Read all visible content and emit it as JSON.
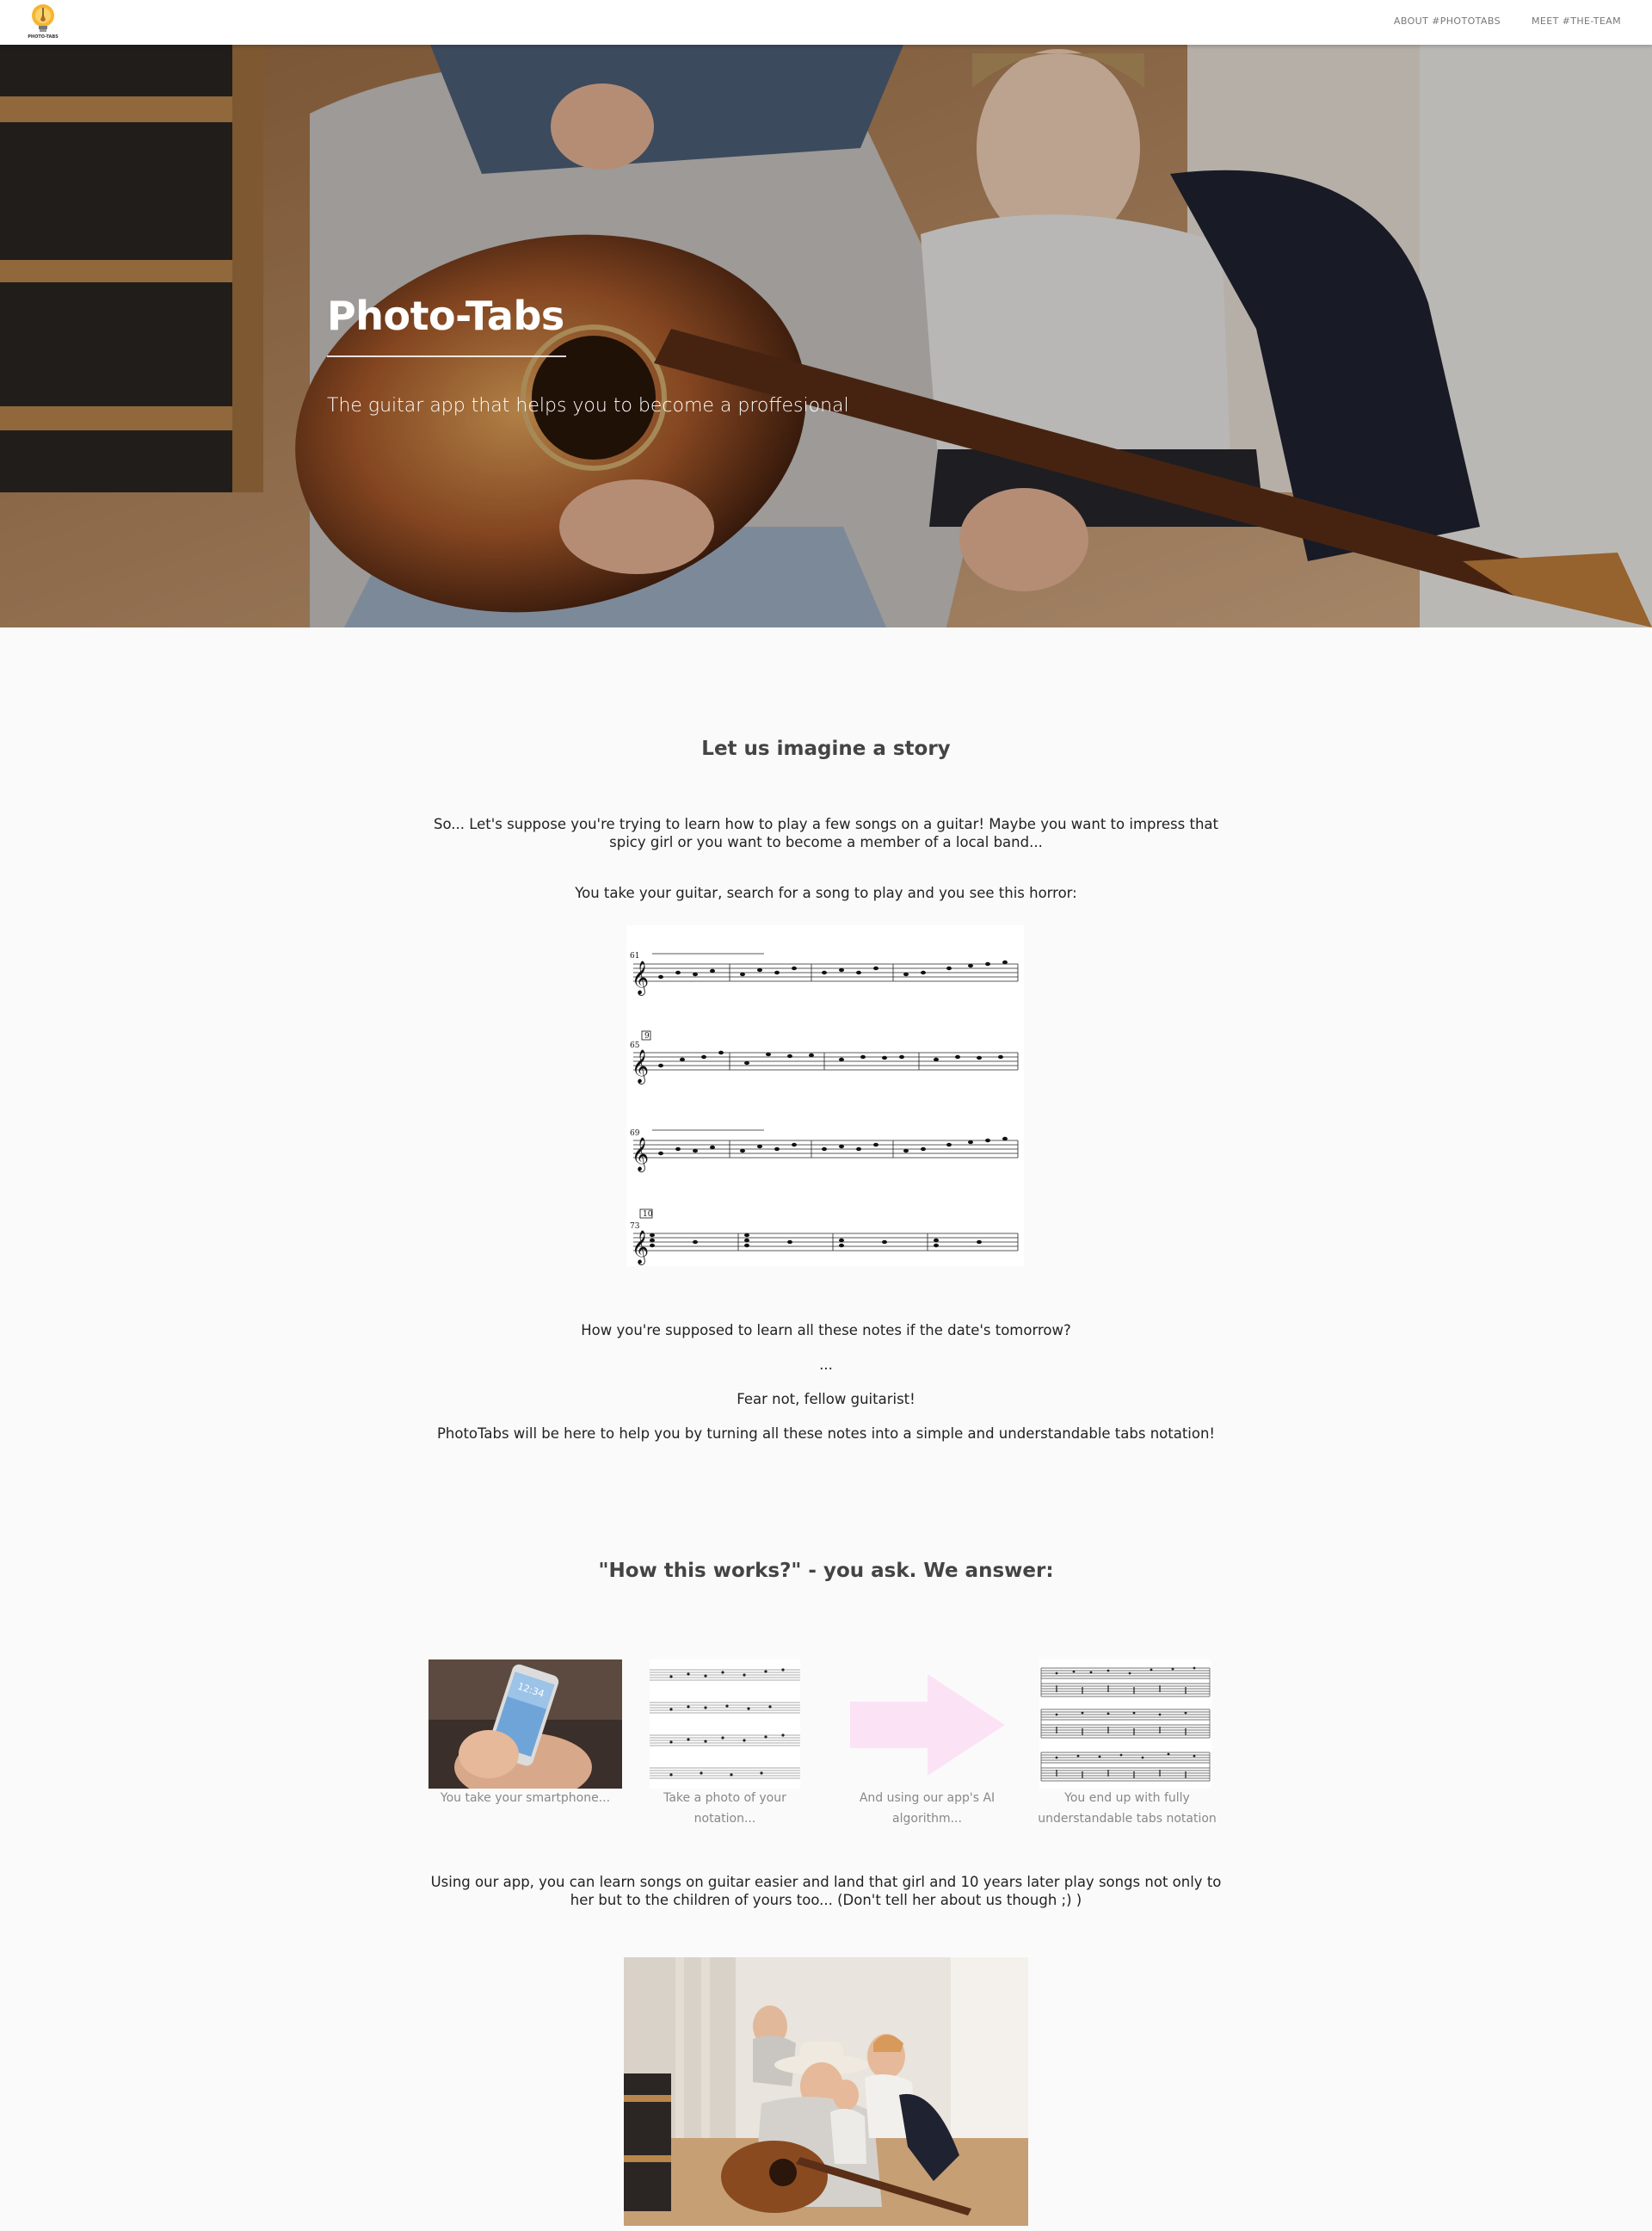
{
  "brand": {
    "logo_text": "PHOTO-TABS"
  },
  "nav": {
    "items": [
      "ABOUT #PHOTOTABS",
      "MEET #THE-TEAM"
    ]
  },
  "hero": {
    "title": "Photo-Tabs",
    "subtitle": "The guitar app that helps you to become a proffesional"
  },
  "story": {
    "title": "Let us imagine a story",
    "p1": "So... Let's suppose you're trying to learn how to play a few songs on a guitar! Maybe you want to impress that spicy girl or you want to become a member of a local band...",
    "p2": "You take your guitar, search for a song to play and you see this horror:",
    "measure_numbers": [
      "61",
      "65",
      "69",
      "73"
    ],
    "rehearsal_marks": [
      "9",
      "10"
    ],
    "p3": "How you're supposed to learn all these notes if the date's tomorrow?",
    "p4": "...",
    "p5": "Fear not, fellow guitarist!",
    "p6": "PhotoTabs will be here to help you by turning all these notes into a simple and understandable tabs notation!"
  },
  "how": {
    "title": "\"How this works?\" - you ask. We answer:",
    "steps": [
      {
        "icon": "smartphone-photo",
        "caption": "You take your smartphone..."
      },
      {
        "icon": "sheet-music-photo",
        "caption": "Take a photo of your notation..."
      },
      {
        "icon": "arrow-right-icon",
        "caption": "And using our app's AI algorithm..."
      },
      {
        "icon": "tabs-notation-image",
        "caption": "You end up with fully understandable tabs notation"
      }
    ],
    "phone_time": "12:34",
    "closing": "Using our app, you can learn songs on guitar easier and land that girl and 10 years later play songs not only to her but to the children of yours too... (Don't tell her about us though ;) )"
  },
  "colors": {
    "arrow": "#fbe3f5",
    "hero_text": "#ffffff",
    "heading": "#444444"
  }
}
